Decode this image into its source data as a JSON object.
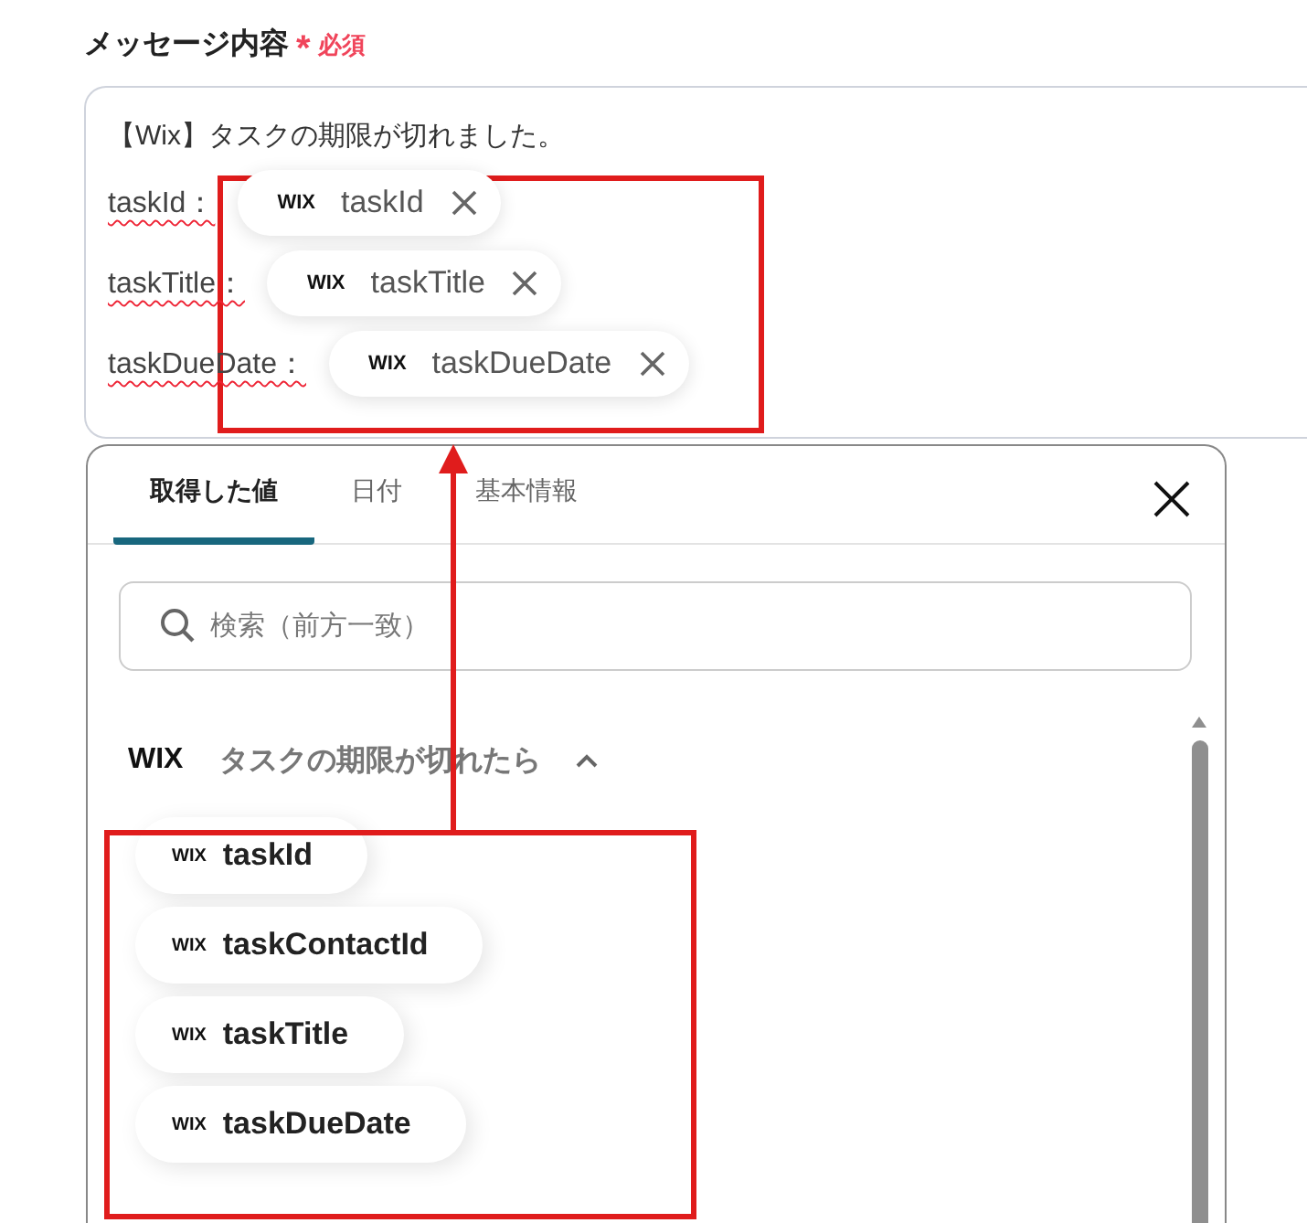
{
  "field": {
    "label": "メッセージ内容",
    "required_mark": "*",
    "required_text": "必須"
  },
  "message": {
    "first_line": "【Wix】タスクの期限が切れました。",
    "lines": [
      {
        "label": "taskId：",
        "token": {
          "logo": "WIX",
          "name": "taskId"
        }
      },
      {
        "label": "taskTitle：",
        "token": {
          "logo": "WIX",
          "name": "taskTitle"
        }
      },
      {
        "label": "taskDueDate：",
        "token": {
          "logo": "WIX",
          "name": "taskDueDate"
        }
      }
    ]
  },
  "picker": {
    "tabs": [
      {
        "label": "取得した値",
        "selected": true
      },
      {
        "label": "日付",
        "selected": false
      },
      {
        "label": "基本情報",
        "selected": false
      }
    ],
    "search": {
      "placeholder": "検索（前方一致）"
    },
    "section": {
      "logo": "WIX",
      "title": "タスクの期限が切れたら",
      "expanded": true
    },
    "items": [
      {
        "logo": "WIX",
        "name": "taskId"
      },
      {
        "logo": "WIX",
        "name": "taskContactId"
      },
      {
        "logo": "WIX",
        "name": "taskTitle"
      },
      {
        "logo": "WIX",
        "name": "taskDueDate"
      }
    ]
  }
}
